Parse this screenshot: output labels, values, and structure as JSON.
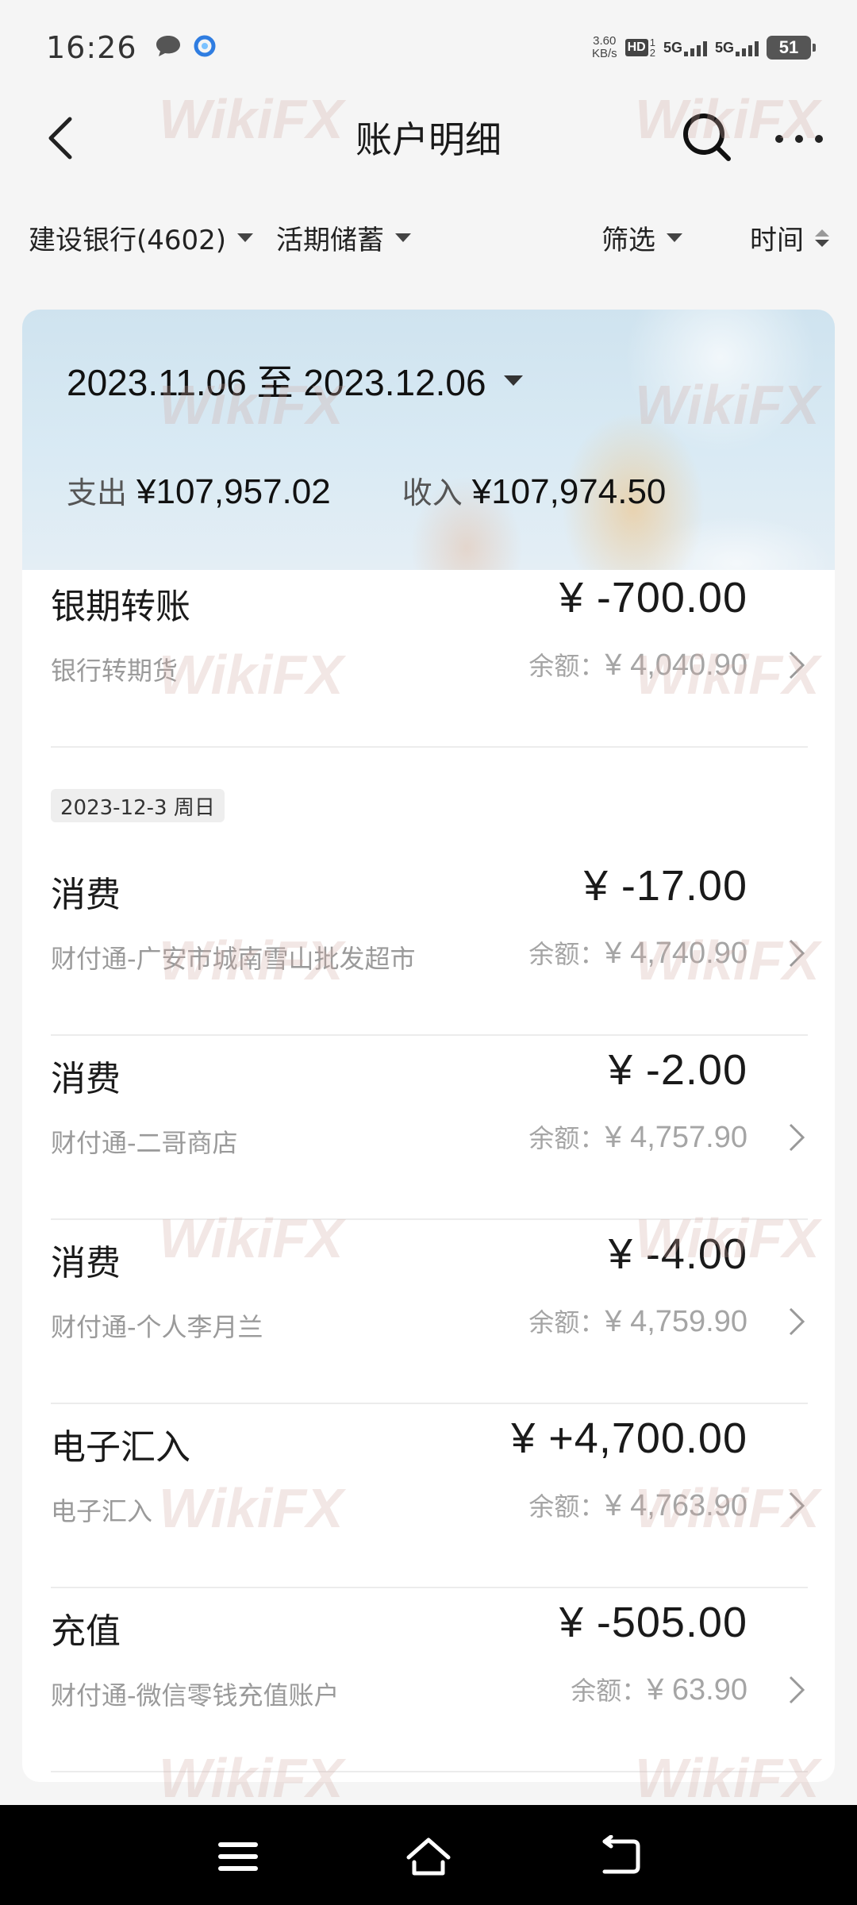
{
  "status_bar": {
    "time": "16:26",
    "net_speed_value": "3.60",
    "net_speed_unit": "KB/s",
    "hd_badge": "HD",
    "signal_1": "5G",
    "signal_2": "5G",
    "battery": "51"
  },
  "header": {
    "title": "账户明细"
  },
  "filters": {
    "account": "建设银行(4602)",
    "account_type": "活期储蓄",
    "filter": "筛选",
    "time": "时间"
  },
  "summary": {
    "date_range": "2023.11.06 至 2023.12.06",
    "expense_label": "支出",
    "expense_value": "¥107,957.02",
    "income_label": "收入",
    "income_value": "¥107,974.50"
  },
  "transactions": [
    {
      "title": "银期转账",
      "amount": "¥ -700.00",
      "desc": "银行转期货",
      "balance_label": "余额：",
      "balance": "¥ 4,040.90"
    },
    {
      "title": "消费",
      "amount": "¥ -17.00",
      "desc": "财付通-广安市城南雪山批发超市",
      "balance_label": "余额：",
      "balance": "¥ 4,740.90"
    },
    {
      "title": "消费",
      "amount": "¥ -2.00",
      "desc": "财付通-二哥商店",
      "balance_label": "余额：",
      "balance": "¥ 4,757.90"
    },
    {
      "title": "消费",
      "amount": "¥ -4.00",
      "desc": "财付通-个人李月兰",
      "balance_label": "余额：",
      "balance": "¥ 4,759.90"
    },
    {
      "title": "电子汇入",
      "amount": "¥ +4,700.00",
      "desc": "电子汇入",
      "balance_label": "余额：",
      "balance": "¥ 4,763.90"
    },
    {
      "title": "充值",
      "amount": "¥ -505.00",
      "desc": "财付通-微信零钱充值账户",
      "balance_label": "余额：",
      "balance": "¥ 63.90"
    }
  ],
  "date_group": "2023-12-3 周日",
  "watermark": "WikiFX"
}
